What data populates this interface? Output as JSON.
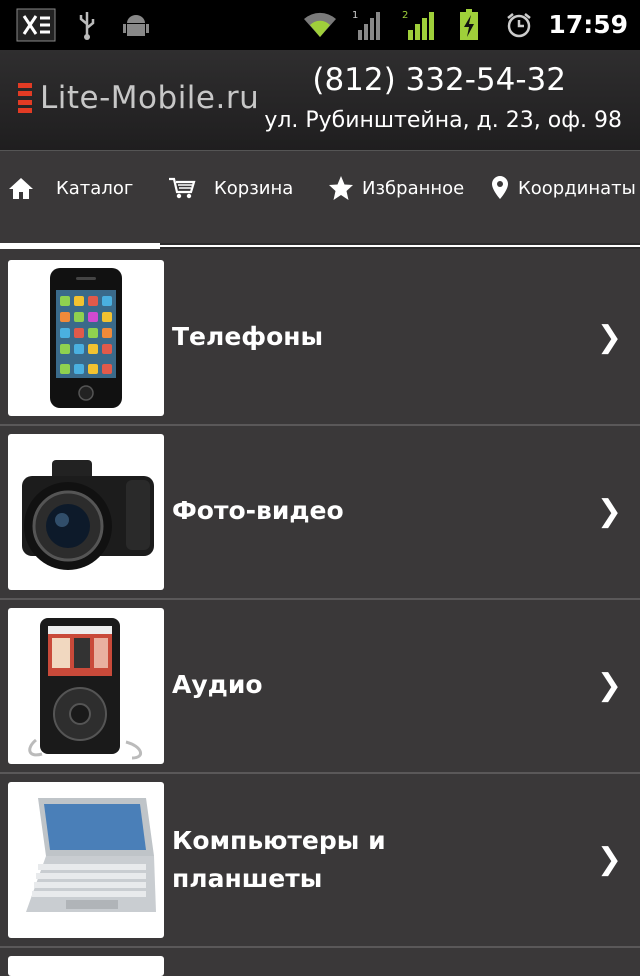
{
  "status_bar": {
    "time": "17:59",
    "icons": [
      "usb-debug-icon",
      "usb-icon",
      "android-icon",
      "wifi-icon",
      "signal-1-icon",
      "signal-2-icon",
      "battery-charging-icon",
      "alarm-icon"
    ]
  },
  "header": {
    "logo": "Lite-Mobile.ru",
    "phone": "(812) 332-54-32",
    "address": "ул. Рубинштейна, д. 23, оф. 98"
  },
  "nav": {
    "items": [
      {
        "label": "Каталог",
        "icon": "home-icon"
      },
      {
        "label": "Корзина",
        "icon": "cart-icon"
      },
      {
        "label": "Избранное",
        "icon": "star-icon"
      },
      {
        "label": "Координаты",
        "icon": "location-pin-icon"
      }
    ]
  },
  "categories": [
    {
      "label_line1": "Телефоны",
      "label_line2": "",
      "image": "phone-image"
    },
    {
      "label_line1": "Фото-видео",
      "label_line2": "",
      "image": "camera-image"
    },
    {
      "label_line1": "Аудио",
      "label_line2": "",
      "image": "mp3-player-image"
    },
    {
      "label_line1": "Компьютеры и",
      "label_line2": "планшеты",
      "image": "laptop-image"
    }
  ],
  "chevron": "❯",
  "colors": {
    "accent": "#e23b24",
    "background": "#3a3839",
    "header": "#1f1e1f"
  }
}
